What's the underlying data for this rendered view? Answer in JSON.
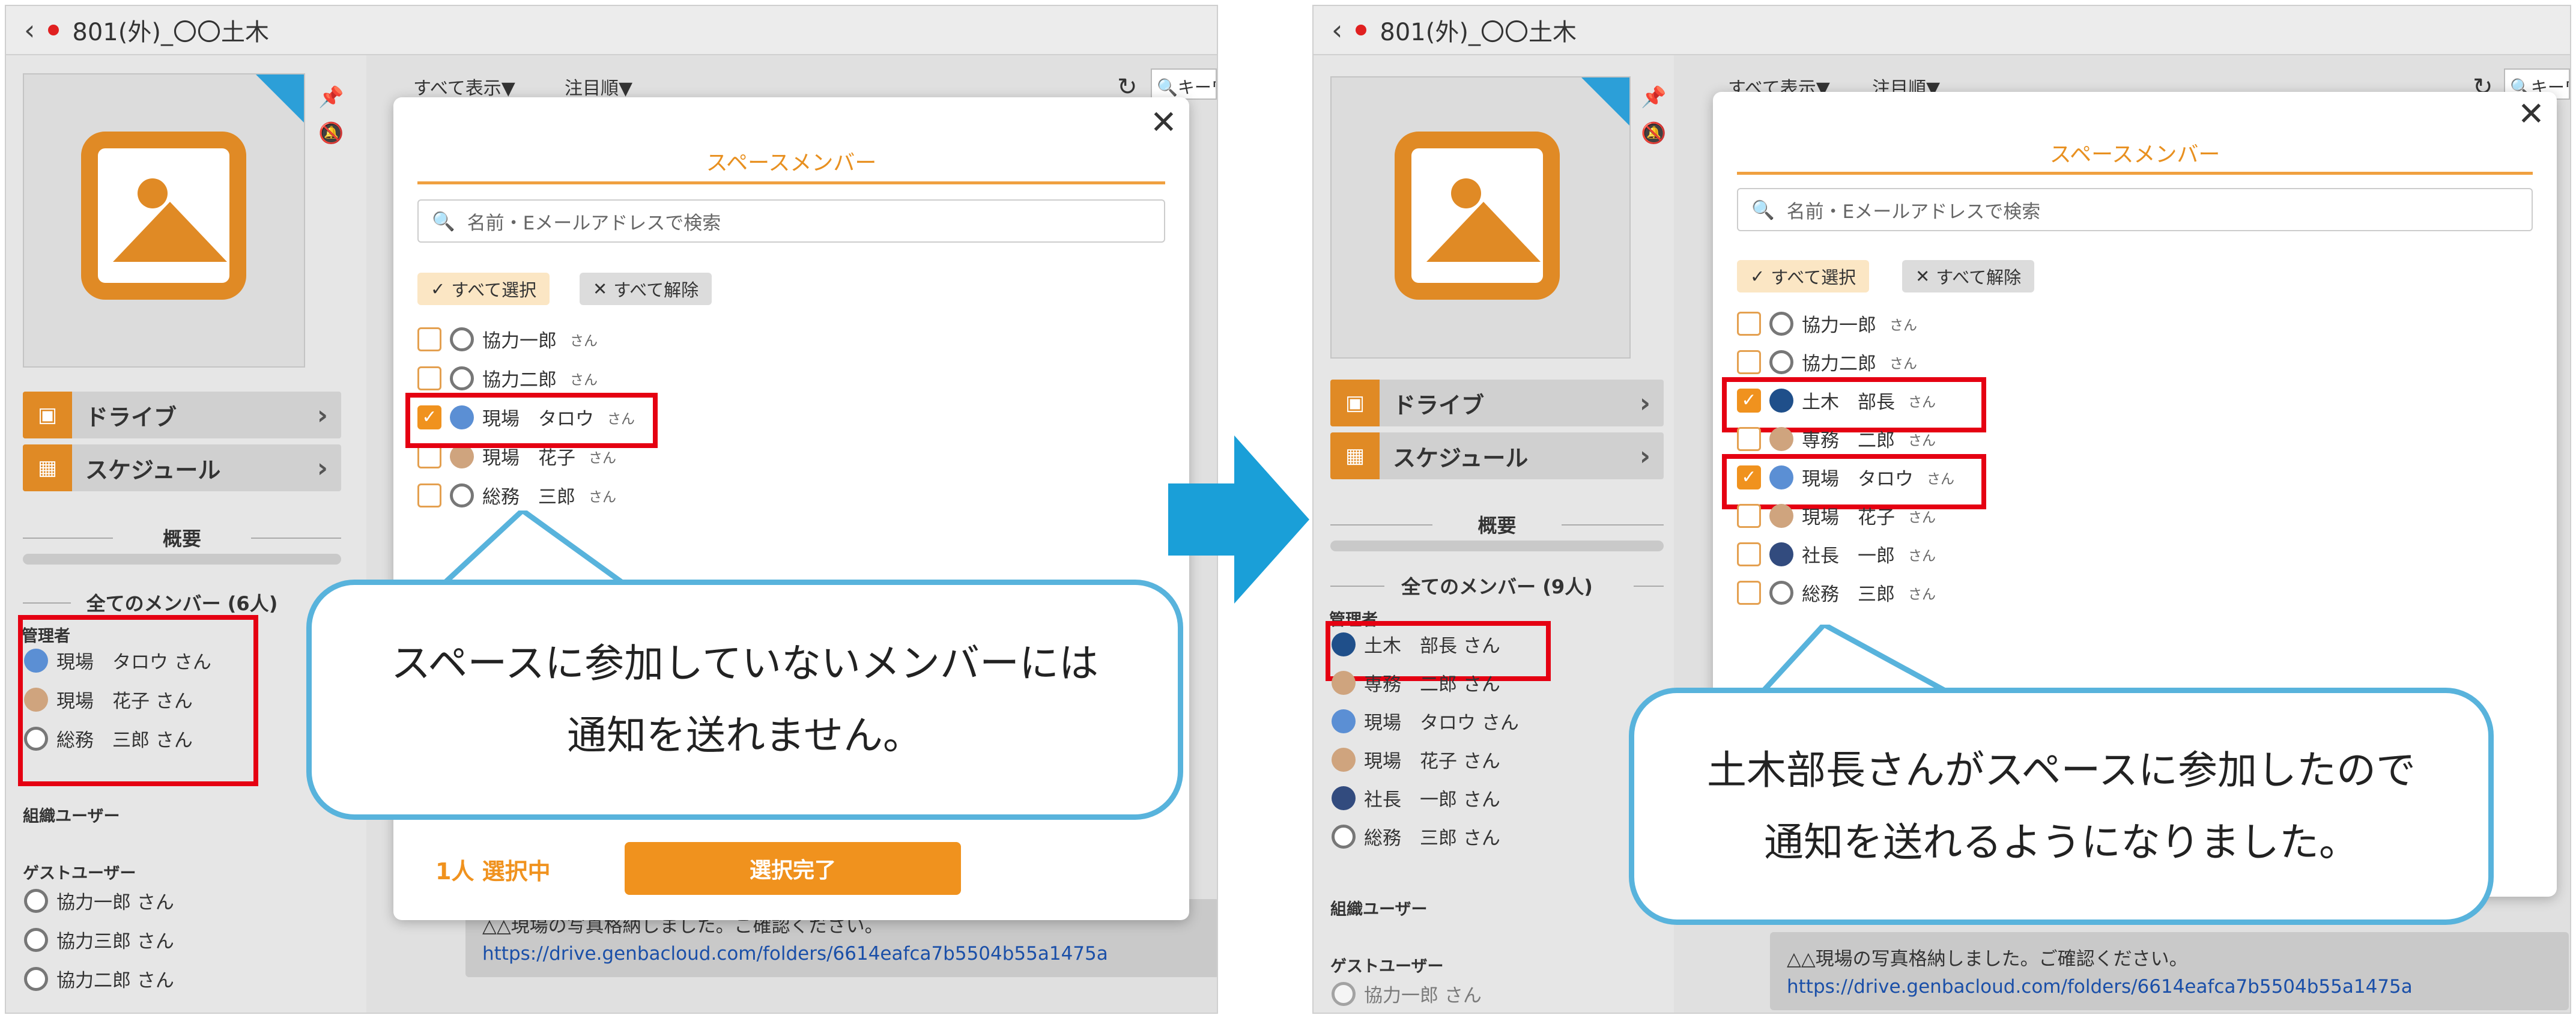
{
  "header": {
    "back": "‹",
    "title": "801(外)_〇〇土木"
  },
  "sidebar": {
    "drive": "ドライブ",
    "schedule": "スケジュール",
    "overview": "概要",
    "admin_label": "管理者",
    "org_users_label": "組織ユーザー",
    "guest_users_label": "ゲストユーザー"
  },
  "toolbar": {
    "show_all": "すべて表示▼",
    "sort": "注目順▼",
    "search": "キーワ"
  },
  "message": {
    "text": "△△現場の写真格納しました。ご確認ください。",
    "link": "https://drive.genbacloud.com/folders/6614eafca7b5504b55a1475a"
  },
  "modal": {
    "title": "スペースメンバー",
    "search_placeholder": "名前・Eメールアドレスで検索",
    "select_all": "すべて選択",
    "deselect_all": "すべて解除",
    "san": "さん",
    "selected_count": "1人 選択中",
    "done": "選択完了"
  },
  "before": {
    "all_members_label": "全てのメンバー (6人)",
    "admins": [
      "現場　タロウ さん",
      "現場　花子 さん",
      "総務　三郎 さん"
    ],
    "guests": [
      "協力一郎 さん",
      "協力三郎 さん",
      "協力二郎 さん"
    ],
    "modal_members": [
      {
        "name": "協力一郎",
        "checked": false,
        "avatar": "gray"
      },
      {
        "name": "協力二郎",
        "checked": false,
        "avatar": "gray"
      },
      {
        "name": "現場　タロウ",
        "checked": true,
        "avatar": "blue"
      },
      {
        "name": "現場　花子",
        "checked": false,
        "avatar": "beige"
      },
      {
        "name": "総務　三郎",
        "checked": false,
        "avatar": "gray"
      }
    ],
    "callout_line1": "スペースに参加していないメンバーには",
    "callout_line2": "通知を送れません。"
  },
  "after": {
    "all_members_label": "全てのメンバー (9人)",
    "admins": [
      "土木　部長 さん",
      "専務　二郎 さん",
      "現場　タロウ さん",
      "現場　花子 さん",
      "社長　一郎 さん",
      "総務　三郎 さん"
    ],
    "guests": [
      "協力一郎 さん"
    ],
    "modal_members": [
      {
        "name": "協力一郎",
        "checked": false,
        "avatar": "gray"
      },
      {
        "name": "協力二郎",
        "checked": false,
        "avatar": "gray"
      },
      {
        "name": "土木　部長",
        "checked": true,
        "avatar": "navy"
      },
      {
        "name": "専務　二郎",
        "checked": false,
        "avatar": "beige"
      },
      {
        "name": "現場　タロウ",
        "checked": true,
        "avatar": "blue"
      },
      {
        "name": "現場　花子",
        "checked": false,
        "avatar": "beige"
      },
      {
        "name": "社長　一郎",
        "checked": false,
        "avatar": "dark"
      },
      {
        "name": "総務　三郎",
        "checked": false,
        "avatar": "gray"
      }
    ],
    "callout_line1": "土木部長さんがスペースに参加したので",
    "callout_line2": "通知を送れるようになりました。"
  },
  "colors": {
    "accent": "#f0921e",
    "callout_border": "#58b3dc",
    "highlight": "#e50012",
    "arrow": "#1a9fd8"
  }
}
